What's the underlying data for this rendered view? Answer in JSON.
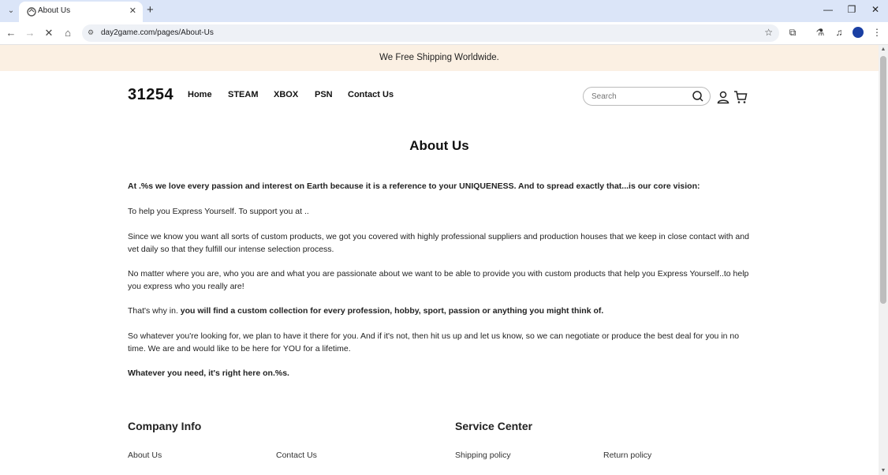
{
  "browser": {
    "tab_title": "About Us",
    "url": "day2game.com/pages/About-Us"
  },
  "announcement": "We Free Shipping Worldwide.",
  "header": {
    "logo": "31254",
    "nav": [
      "Home",
      "STEAM",
      "XBOX",
      "PSN",
      "Contact Us"
    ],
    "search_placeholder": "Search"
  },
  "page": {
    "title": "About Us",
    "p1": "At .%s we love every passion and interest on Earth because it is a reference to your UNIQUENESS. And to spread exactly that...is our core vision:",
    "p2": "To help you Express Yourself. To support you at ..",
    "p3": "Since we know you want all sorts of custom products, we got you covered with highly professional suppliers and production houses that we keep in close contact with and vet daily so that they fulfill our intense selection process.",
    "p4": "No matter where you are, who you are and what you are passionate about we want to be able to provide you with custom products that help you Express Yourself..to help you express who you really are!",
    "p5_plain": "That's why in. ",
    "p5_bold": "you will find a custom collection for every profession, hobby, sport, passion or anything you might think of.",
    "p6": "So whatever you're looking for, we plan to have it there for you. And if it's not, then hit us up and let us know, so we can negotiate or produce the best deal for you in no time. We are and would like to be here for YOU for a lifetime.",
    "p7": "Whatever you need, it's right here on.%s."
  },
  "footer": {
    "company_heading": "Company Info",
    "service_heading": "Service Center",
    "company_links": [
      "About Us",
      "Contact Us"
    ],
    "service_links": [
      "Shipping policy",
      "Return policy"
    ]
  }
}
